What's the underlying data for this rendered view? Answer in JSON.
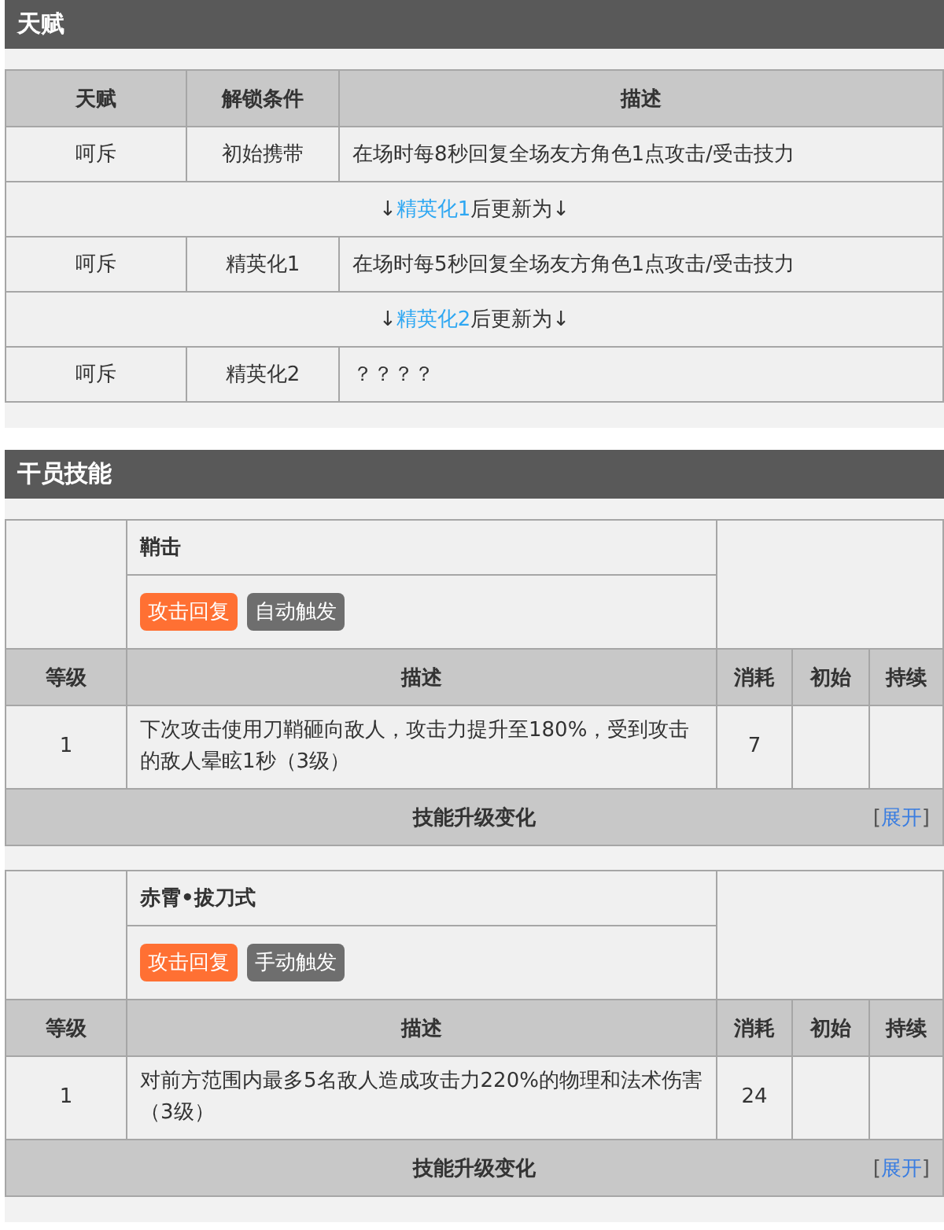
{
  "talent_section": {
    "title": "天赋",
    "columns": [
      "天赋",
      "解锁条件",
      "描述"
    ],
    "rows": [
      {
        "kind": "talent",
        "name": "呵斥",
        "condition": "初始携带",
        "description": "在场时每8秒回复全场友方角色1点攻击/受击技力"
      },
      {
        "kind": "update",
        "prefix": "↓",
        "link": "精英化1",
        "suffix": "后更新为↓"
      },
      {
        "kind": "talent",
        "name": "呵斥",
        "condition": "精英化1",
        "description": "在场时每5秒回复全场友方角色1点攻击/受击技力"
      },
      {
        "kind": "update",
        "prefix": "↓",
        "link": "精英化2",
        "suffix": "后更新为↓"
      },
      {
        "kind": "talent",
        "name": "呵斥",
        "condition": "精英化2",
        "description": "？？？？"
      }
    ]
  },
  "skill_section": {
    "title": "干员技能",
    "skills": [
      {
        "name": "鞘击",
        "tags": [
          {
            "label": "攻击回复",
            "color": "#ff7033"
          },
          {
            "label": "自动触发",
            "color": "#6e6e6e"
          }
        ],
        "columns": [
          "等级",
          "描述",
          "消耗",
          "初始",
          "持续"
        ],
        "rows": [
          {
            "level": "1",
            "description": "下次攻击使用刀鞘砸向敌人，攻击力提升至180%，受到攻击的敌人晕眩1秒（3级）",
            "cost": "7"
          }
        ],
        "footer": "技能升级变化",
        "expand": {
          "open": "[",
          "label": "展开",
          "close": "]"
        }
      },
      {
        "name": "赤霄•拔刀式",
        "tags": [
          {
            "label": "攻击回复",
            "color": "#ff7033"
          },
          {
            "label": "手动触发",
            "color": "#6e6e6e"
          }
        ],
        "columns": [
          "等级",
          "描述",
          "消耗",
          "初始",
          "持续"
        ],
        "rows": [
          {
            "level": "1",
            "description": "对前方范围内最多5名敌人造成攻击力220%的物理和法术伤害（3级）",
            "cost": "24"
          }
        ],
        "footer": "技能升级变化",
        "expand": {
          "open": "[",
          "label": "展开",
          "close": "]"
        }
      }
    ]
  }
}
